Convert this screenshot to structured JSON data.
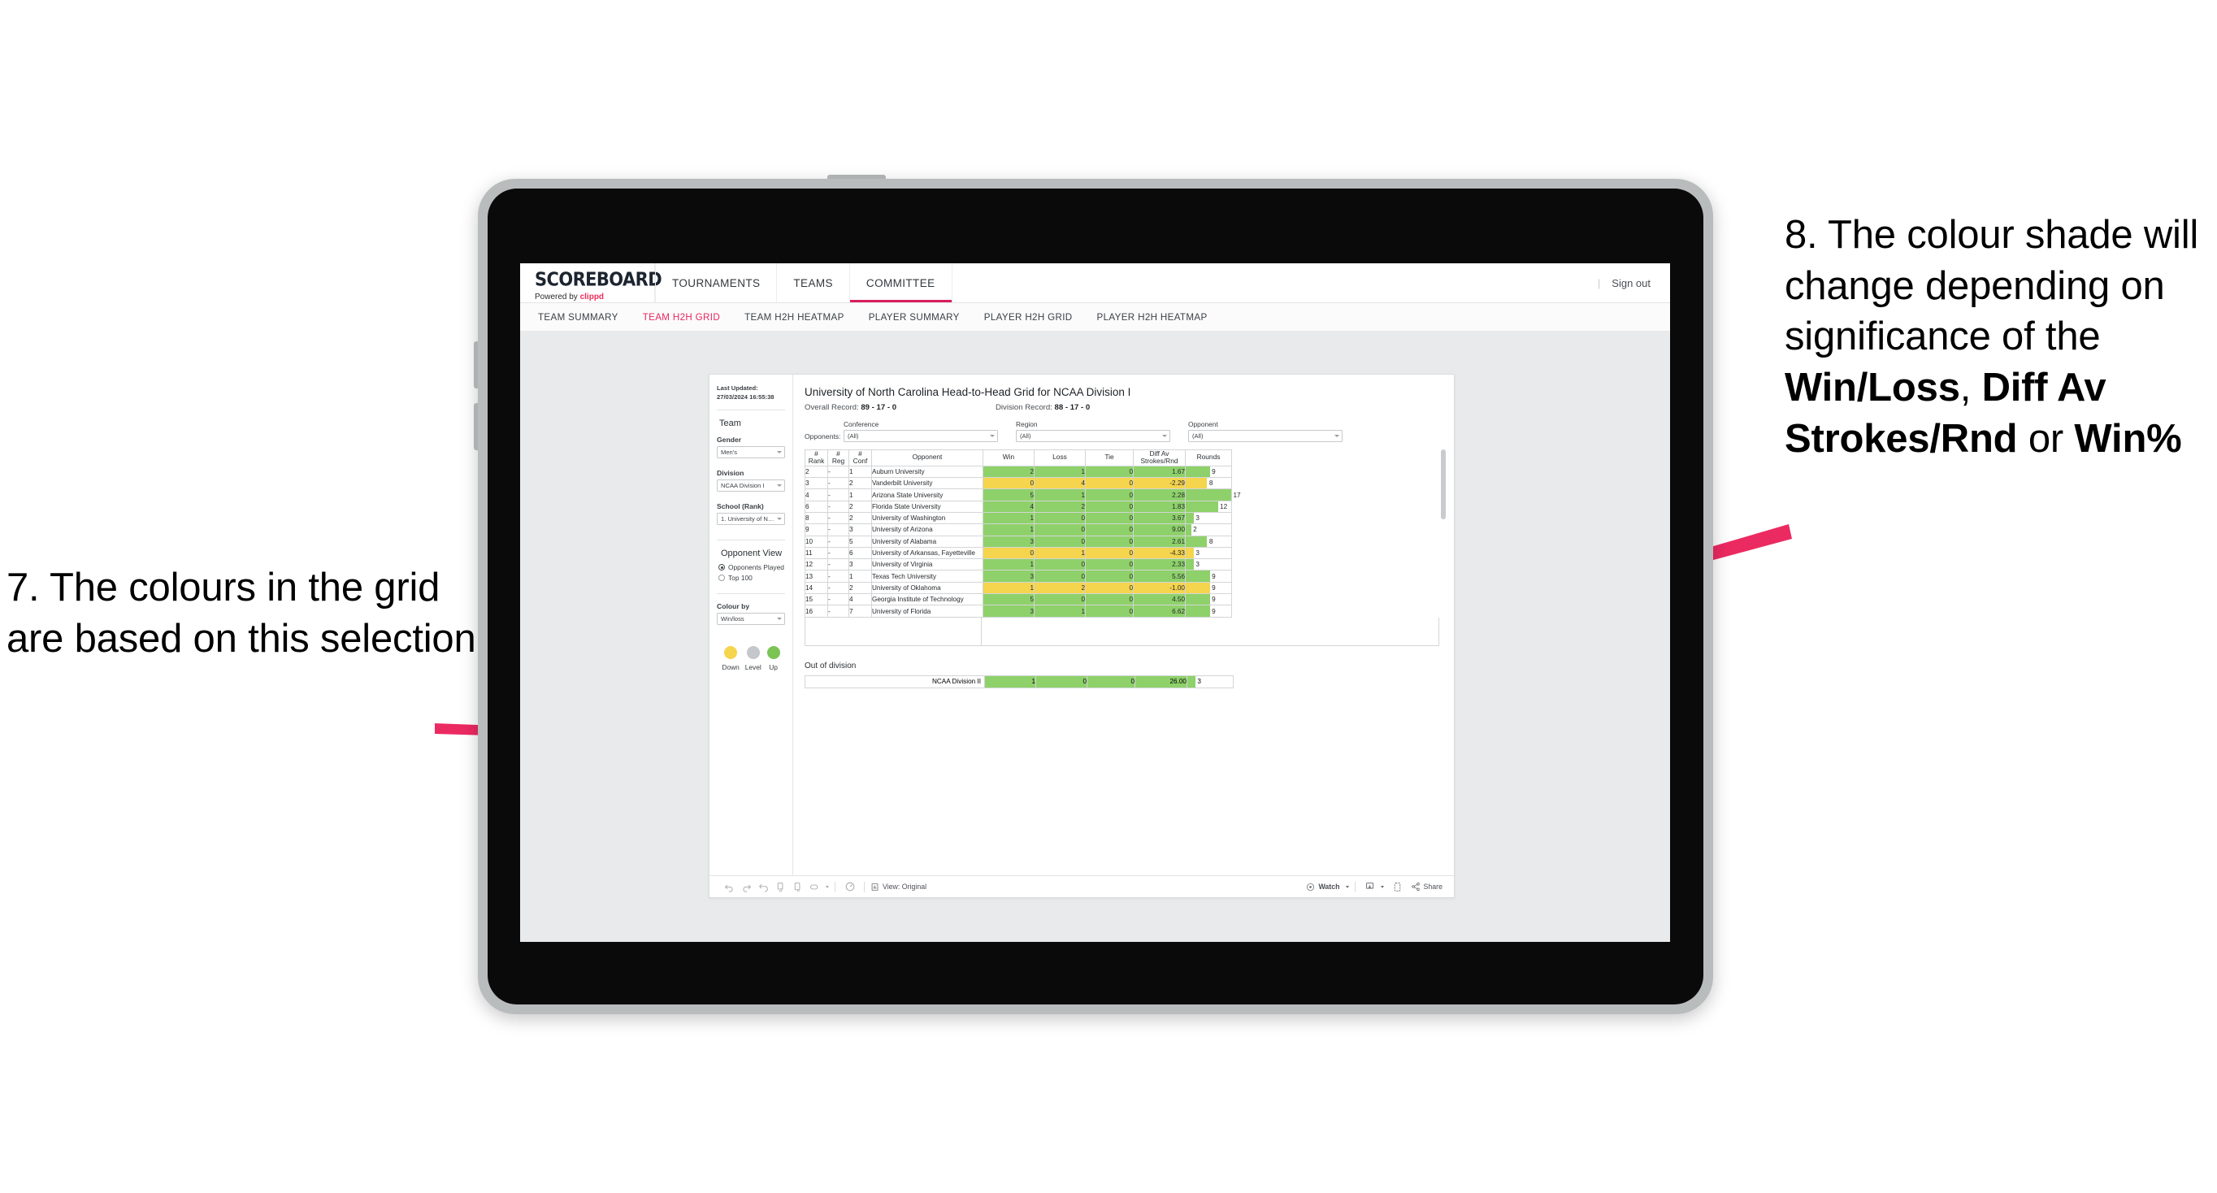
{
  "annotations": {
    "left": {
      "text": "7. The colours in the grid are based on this selection"
    },
    "right": {
      "part1": "8. The colour shade will change depending on significance of the ",
      "bold1": "Win/Loss",
      "mid1": ", ",
      "bold2": "Diff Av Strokes/Rnd",
      "mid2": " or ",
      "bold3": "Win%"
    },
    "arrow_color": "#ec2a62"
  },
  "header": {
    "brand_title": "SCOREBOARD",
    "brand_powered_prefix": "Powered by ",
    "brand_powered_name": "clippd",
    "nav": [
      {
        "label": "TOURNAMENTS",
        "active": false
      },
      {
        "label": "TEAMS",
        "active": false
      },
      {
        "label": "COMMITTEE",
        "active": true
      }
    ],
    "sign_out": "Sign out",
    "separator": "|"
  },
  "subnav": [
    {
      "label": "TEAM SUMMARY",
      "active": false
    },
    {
      "label": "TEAM H2H GRID",
      "active": true
    },
    {
      "label": "TEAM H2H HEATMAP",
      "active": false
    },
    {
      "label": "PLAYER SUMMARY",
      "active": false
    },
    {
      "label": "PLAYER H2H GRID",
      "active": false
    },
    {
      "label": "PLAYER H2H HEATMAP",
      "active": false
    }
  ],
  "sidebar": {
    "last_updated": "Last Updated: 27/03/2024 16:55:38",
    "team_heading": "Team",
    "filters": [
      {
        "label": "Gender",
        "value": "Men's"
      },
      {
        "label": "Division",
        "value": "NCAA Division I"
      },
      {
        "label": "School (Rank)",
        "value": "1. University of Nort..."
      }
    ],
    "opponent_view_heading": "Opponent View",
    "opponent_view_options": [
      {
        "label": "Opponents Played",
        "selected": true
      },
      {
        "label": "Top 100",
        "selected": false
      }
    ],
    "colour_by_label": "Colour by",
    "colour_by_value": "Win/loss",
    "legend": [
      {
        "label": "Down",
        "color": "#f5d44e"
      },
      {
        "label": "Level",
        "color": "#c4c7cb"
      },
      {
        "label": "Up",
        "color": "#7cc356"
      }
    ]
  },
  "main": {
    "title": "University of North Carolina Head-to-Head Grid for NCAA Division I",
    "overall_record_label": "Overall Record: ",
    "overall_record_value": "89 - 17 - 0",
    "division_record_label": "Division Record: ",
    "division_record_value": "88 - 17 - 0",
    "opponents_label": "Opponents:",
    "opponent_filters": [
      {
        "label": "Conference",
        "value": "(All)"
      },
      {
        "label": "Region",
        "value": "(All)"
      },
      {
        "label": "Opponent",
        "value": "(All)"
      }
    ],
    "out_of_division_title": "Out of division",
    "out_of_division_row": {
      "name": "NCAA Division II",
      "win": "1",
      "loss": "0",
      "tie": "0",
      "diff": "26.00",
      "rounds": "3",
      "colour": "green"
    }
  },
  "chart_data": {
    "type": "table",
    "title": "University of North Carolina Head-to-Head Grid for NCAA Division I",
    "columns": [
      "# Rank",
      "# Reg",
      "# Conf",
      "Opponent",
      "Win",
      "Loss",
      "Tie",
      "Diff Av Strokes/Rnd",
      "Rounds"
    ],
    "column_headers_multiline": [
      [
        "#",
        "Rank"
      ],
      [
        "#",
        "Reg"
      ],
      [
        "#",
        "Conf"
      ],
      [
        "Opponent"
      ],
      [
        "Win"
      ],
      [
        "Loss"
      ],
      [
        "Tie"
      ],
      [
        "Diff Av",
        "Strokes/Rnd"
      ],
      [
        "Rounds"
      ]
    ],
    "rounds_max": 17,
    "colour_legend": {
      "green": "#8ed16a",
      "yellow": "#f5d44e",
      "grey": "#c4c7cb"
    },
    "rows": [
      {
        "rank": "2",
        "reg": "-",
        "conf": "1",
        "opponent": "Auburn University",
        "win": "2",
        "loss": "1",
        "tie": "0",
        "diff": "1.67",
        "rounds": "9",
        "colour": "green"
      },
      {
        "rank": "3",
        "reg": "-",
        "conf": "2",
        "opponent": "Vanderbilt University",
        "win": "0",
        "loss": "4",
        "tie": "0",
        "diff": "-2.29",
        "rounds": "8",
        "colour": "yellow"
      },
      {
        "rank": "4",
        "reg": "-",
        "conf": "1",
        "opponent": "Arizona State University",
        "win": "5",
        "loss": "1",
        "tie": "0",
        "diff": "2.28",
        "rounds": "17",
        "colour": "green"
      },
      {
        "rank": "6",
        "reg": "-",
        "conf": "2",
        "opponent": "Florida State University",
        "win": "4",
        "loss": "2",
        "tie": "0",
        "diff": "1.83",
        "rounds": "12",
        "colour": "green"
      },
      {
        "rank": "8",
        "reg": "-",
        "conf": "2",
        "opponent": "University of Washington",
        "win": "1",
        "loss": "0",
        "tie": "0",
        "diff": "3.67",
        "rounds": "3",
        "colour": "green"
      },
      {
        "rank": "9",
        "reg": "-",
        "conf": "3",
        "opponent": "University of Arizona",
        "win": "1",
        "loss": "0",
        "tie": "0",
        "diff": "9.00",
        "rounds": "2",
        "colour": "green"
      },
      {
        "rank": "10",
        "reg": "-",
        "conf": "5",
        "opponent": "University of Alabama",
        "win": "3",
        "loss": "0",
        "tie": "0",
        "diff": "2.61",
        "rounds": "8",
        "colour": "green"
      },
      {
        "rank": "11",
        "reg": "-",
        "conf": "6",
        "opponent": "University of Arkansas, Fayetteville",
        "win": "0",
        "loss": "1",
        "tie": "0",
        "diff": "-4.33",
        "rounds": "3",
        "colour": "yellow"
      },
      {
        "rank": "12",
        "reg": "-",
        "conf": "3",
        "opponent": "University of Virginia",
        "win": "1",
        "loss": "0",
        "tie": "0",
        "diff": "2.33",
        "rounds": "3",
        "colour": "green"
      },
      {
        "rank": "13",
        "reg": "-",
        "conf": "1",
        "opponent": "Texas Tech University",
        "win": "3",
        "loss": "0",
        "tie": "0",
        "diff": "5.56",
        "rounds": "9",
        "colour": "green"
      },
      {
        "rank": "14",
        "reg": "-",
        "conf": "2",
        "opponent": "University of Oklahoma",
        "win": "1",
        "loss": "2",
        "tie": "0",
        "diff": "-1.00",
        "rounds": "9",
        "colour": "yellow"
      },
      {
        "rank": "15",
        "reg": "-",
        "conf": "4",
        "opponent": "Georgia Institute of Technology",
        "win": "5",
        "loss": "0",
        "tie": "0",
        "diff": "4.50",
        "rounds": "9",
        "colour": "green"
      },
      {
        "rank": "16",
        "reg": "-",
        "conf": "7",
        "opponent": "University of Florida",
        "win": "3",
        "loss": "1",
        "tie": "0",
        "diff": "6.62",
        "rounds": "9",
        "colour": "green"
      }
    ]
  },
  "toolbar": {
    "view_label": "View: Original",
    "watch_label": "Watch",
    "share_label": "Share"
  }
}
